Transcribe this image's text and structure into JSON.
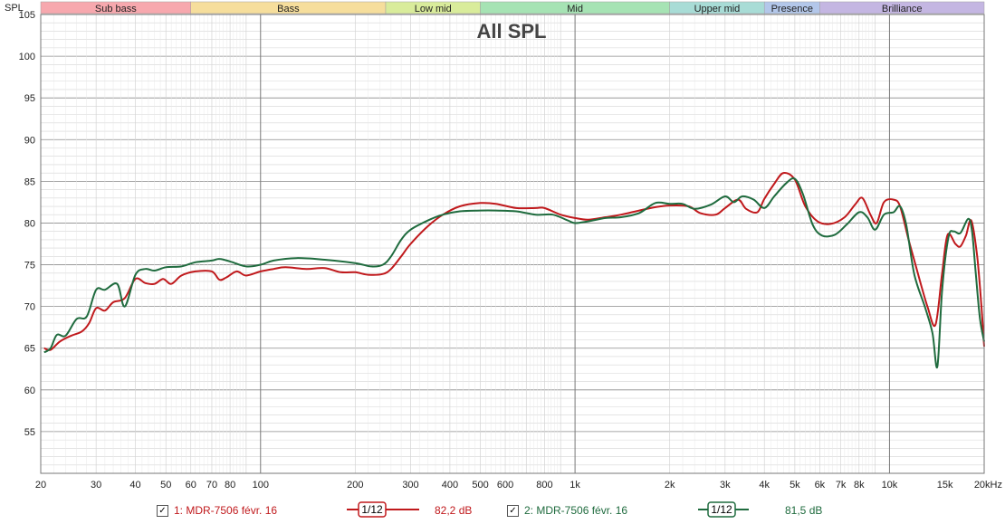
{
  "colors": {
    "series1": "#c0191c",
    "series2": "#1f6b3e",
    "grid_major": "#8c8c8c",
    "grid_minor": "#d4d4d4",
    "band_sub_bass": "#f7a8ae",
    "band_bass": "#f6de9c",
    "band_low_mid": "#d9ec9b",
    "band_mid": "#a6e3b4",
    "band_upper_mid": "#a8dcd6",
    "band_presence": "#b3c7ea",
    "band_brilliance": "#c4b6e2"
  },
  "chart_data": {
    "type": "line",
    "title": "All SPL",
    "ylabel": "SPL",
    "xscale": "log",
    "xlim": [
      20,
      20000
    ],
    "ylim": [
      50,
      105
    ],
    "grid": true,
    "y_ticks": [
      "105",
      "100",
      "95",
      "90",
      "85",
      "80",
      "75",
      "70",
      "65",
      "60",
      "55"
    ],
    "x_ticks": [
      {
        "value": 20,
        "label": "20"
      },
      {
        "value": 30,
        "label": "30"
      },
      {
        "value": 40,
        "label": "40"
      },
      {
        "value": 50,
        "label": "50"
      },
      {
        "value": 60,
        "label": "60"
      },
      {
        "value": 70,
        "label": "70"
      },
      {
        "value": 80,
        "label": "80"
      },
      {
        "value": 100,
        "label": "100"
      },
      {
        "value": 200,
        "label": "200"
      },
      {
        "value": 300,
        "label": "300"
      },
      {
        "value": 400,
        "label": "400"
      },
      {
        "value": 500,
        "label": "500"
      },
      {
        "value": 600,
        "label": "600"
      },
      {
        "value": 800,
        "label": "800"
      },
      {
        "value": 1000,
        "label": "1k"
      },
      {
        "value": 2000,
        "label": "2k"
      },
      {
        "value": 3000,
        "label": "3k"
      },
      {
        "value": 4000,
        "label": "4k"
      },
      {
        "value": 5000,
        "label": "5k"
      },
      {
        "value": 6000,
        "label": "6k"
      },
      {
        "value": 7000,
        "label": "7k"
      },
      {
        "value": 8000,
        "label": "8k"
      },
      {
        "value": 10000,
        "label": "10k"
      },
      {
        "value": 15000,
        "label": "15k"
      },
      {
        "value": 20000,
        "label": "20kHz"
      }
    ],
    "bands": [
      {
        "name": "Sub bass",
        "from": 20,
        "to": 60,
        "color": "#f7a8ae"
      },
      {
        "name": "Bass",
        "from": 60,
        "to": 250,
        "color": "#f6de9c"
      },
      {
        "name": "Low mid",
        "from": 250,
        "to": 500,
        "color": "#d9ec9b"
      },
      {
        "name": "Mid",
        "from": 500,
        "to": 2000,
        "color": "#a6e3b4"
      },
      {
        "name": "Upper mid",
        "from": 2000,
        "to": 4000,
        "color": "#a8dcd6"
      },
      {
        "name": "Presence",
        "from": 4000,
        "to": 6000,
        "color": "#b3c7ea"
      },
      {
        "name": "Brilliance",
        "from": 6000,
        "to": 20000,
        "color": "#c4b6e2"
      }
    ],
    "series": [
      {
        "name": "1: MDR-7506 févr. 16",
        "color": "#c0191c",
        "points": [
          [
            20.5,
            65.0
          ],
          [
            21.5,
            64.8
          ],
          [
            23,
            65.8
          ],
          [
            25,
            66.5
          ],
          [
            27,
            67.0
          ],
          [
            28.5,
            68.0
          ],
          [
            30,
            69.8
          ],
          [
            32,
            69.5
          ],
          [
            34,
            70.5
          ],
          [
            37,
            71.0
          ],
          [
            40,
            73.3
          ],
          [
            43,
            72.8
          ],
          [
            46,
            72.7
          ],
          [
            49,
            73.3
          ],
          [
            52,
            72.7
          ],
          [
            56,
            73.7
          ],
          [
            62,
            74.2
          ],
          [
            70,
            74.2
          ],
          [
            74,
            73.2
          ],
          [
            78,
            73.5
          ],
          [
            84,
            74.2
          ],
          [
            90,
            73.7
          ],
          [
            100,
            74.2
          ],
          [
            110,
            74.5
          ],
          [
            120,
            74.7
          ],
          [
            140,
            74.5
          ],
          [
            160,
            74.6
          ],
          [
            180,
            74.1
          ],
          [
            200,
            74.1
          ],
          [
            220,
            73.8
          ],
          [
            245,
            73.9
          ],
          [
            260,
            74.5
          ],
          [
            280,
            76.0
          ],
          [
            300,
            77.5
          ],
          [
            340,
            79.6
          ],
          [
            380,
            81.0
          ],
          [
            430,
            82.0
          ],
          [
            500,
            82.4
          ],
          [
            560,
            82.3
          ],
          [
            650,
            81.8
          ],
          [
            750,
            81.8
          ],
          [
            800,
            81.8
          ],
          [
            900,
            81.0
          ],
          [
            1000,
            80.6
          ],
          [
            1100,
            80.4
          ],
          [
            1250,
            80.7
          ],
          [
            1400,
            81.0
          ],
          [
            1600,
            81.5
          ],
          [
            1800,
            81.9
          ],
          [
            2000,
            82.1
          ],
          [
            2300,
            82.0
          ],
          [
            2500,
            81.2
          ],
          [
            2800,
            81.0
          ],
          [
            3000,
            81.8
          ],
          [
            3300,
            82.8
          ],
          [
            3500,
            81.7
          ],
          [
            3800,
            81.3
          ],
          [
            4000,
            82.9
          ],
          [
            4300,
            84.7
          ],
          [
            4600,
            86.0
          ],
          [
            5000,
            85.2
          ],
          [
            5400,
            82.0
          ],
          [
            5900,
            80.2
          ],
          [
            6500,
            79.9
          ],
          [
            7200,
            80.7
          ],
          [
            7800,
            82.3
          ],
          [
            8200,
            83.0
          ],
          [
            8700,
            81.0
          ],
          [
            9100,
            80.0
          ],
          [
            9600,
            82.5
          ],
          [
            10300,
            82.8
          ],
          [
            10800,
            82.0
          ],
          [
            11500,
            78.0
          ],
          [
            12300,
            74.0
          ],
          [
            13200,
            70.0
          ],
          [
            14000,
            67.8
          ],
          [
            14700,
            74.0
          ],
          [
            15300,
            78.6
          ],
          [
            16200,
            77.5
          ],
          [
            16800,
            77.2
          ],
          [
            17500,
            78.5
          ],
          [
            18200,
            80.3
          ],
          [
            19000,
            76.0
          ],
          [
            19600,
            70.0
          ],
          [
            20000,
            65.2
          ]
        ]
      },
      {
        "name": "2: MDR-7506 févr. 16",
        "color": "#1f6b3e",
        "points": [
          [
            20.5,
            64.5
          ],
          [
            21.5,
            65.0
          ],
          [
            22.5,
            66.6
          ],
          [
            24,
            66.5
          ],
          [
            26,
            68.5
          ],
          [
            28,
            68.8
          ],
          [
            30,
            72.0
          ],
          [
            32,
            72.0
          ],
          [
            35,
            72.7
          ],
          [
            37,
            70.0
          ],
          [
            40,
            73.8
          ],
          [
            43,
            74.5
          ],
          [
            46,
            74.3
          ],
          [
            50,
            74.7
          ],
          [
            56,
            74.8
          ],
          [
            62,
            75.3
          ],
          [
            70,
            75.5
          ],
          [
            74,
            75.7
          ],
          [
            80,
            75.4
          ],
          [
            90,
            74.8
          ],
          [
            100,
            75.0
          ],
          [
            110,
            75.5
          ],
          [
            130,
            75.8
          ],
          [
            160,
            75.6
          ],
          [
            200,
            75.2
          ],
          [
            225,
            74.8
          ],
          [
            245,
            75.0
          ],
          [
            260,
            76.0
          ],
          [
            280,
            78.0
          ],
          [
            300,
            79.2
          ],
          [
            340,
            80.3
          ],
          [
            380,
            81.0
          ],
          [
            430,
            81.4
          ],
          [
            500,
            81.5
          ],
          [
            560,
            81.5
          ],
          [
            650,
            81.4
          ],
          [
            750,
            81.0
          ],
          [
            850,
            81.0
          ],
          [
            950,
            80.3
          ],
          [
            1000,
            80.0
          ],
          [
            1100,
            80.2
          ],
          [
            1250,
            80.6
          ],
          [
            1400,
            80.7
          ],
          [
            1600,
            81.2
          ],
          [
            1800,
            82.4
          ],
          [
            2000,
            82.3
          ],
          [
            2200,
            82.3
          ],
          [
            2400,
            81.7
          ],
          [
            2700,
            82.2
          ],
          [
            3000,
            83.2
          ],
          [
            3200,
            82.5
          ],
          [
            3400,
            83.2
          ],
          [
            3700,
            82.8
          ],
          [
            4000,
            81.8
          ],
          [
            4300,
            83.2
          ],
          [
            4700,
            84.8
          ],
          [
            5000,
            85.3
          ],
          [
            5300,
            83.5
          ],
          [
            5700,
            79.8
          ],
          [
            6100,
            78.5
          ],
          [
            6700,
            78.6
          ],
          [
            7300,
            79.8
          ],
          [
            8000,
            81.3
          ],
          [
            8500,
            80.7
          ],
          [
            9000,
            79.2
          ],
          [
            9600,
            81.0
          ],
          [
            10300,
            81.3
          ],
          [
            10800,
            82.0
          ],
          [
            11300,
            79.8
          ],
          [
            12000,
            73.8
          ],
          [
            13000,
            69.8
          ],
          [
            13700,
            66.8
          ],
          [
            14200,
            62.8
          ],
          [
            14700,
            72.0
          ],
          [
            15400,
            78.3
          ],
          [
            16000,
            79.0
          ],
          [
            16800,
            78.8
          ],
          [
            17800,
            80.5
          ],
          [
            18300,
            79.0
          ],
          [
            18800,
            74.0
          ],
          [
            19400,
            68.5
          ],
          [
            20000,
            65.8
          ]
        ]
      }
    ]
  },
  "legend": {
    "series1_checkbox": "✓",
    "series1_label": "1: MDR-7506 févr. 16",
    "series1_smoothing": "1/12",
    "series1_level": "82,2 dB",
    "series2_checkbox": "✓",
    "series2_label": "2: MDR-7506 févr. 16",
    "series2_smoothing": "1/12",
    "series2_level": "81,5 dB"
  }
}
